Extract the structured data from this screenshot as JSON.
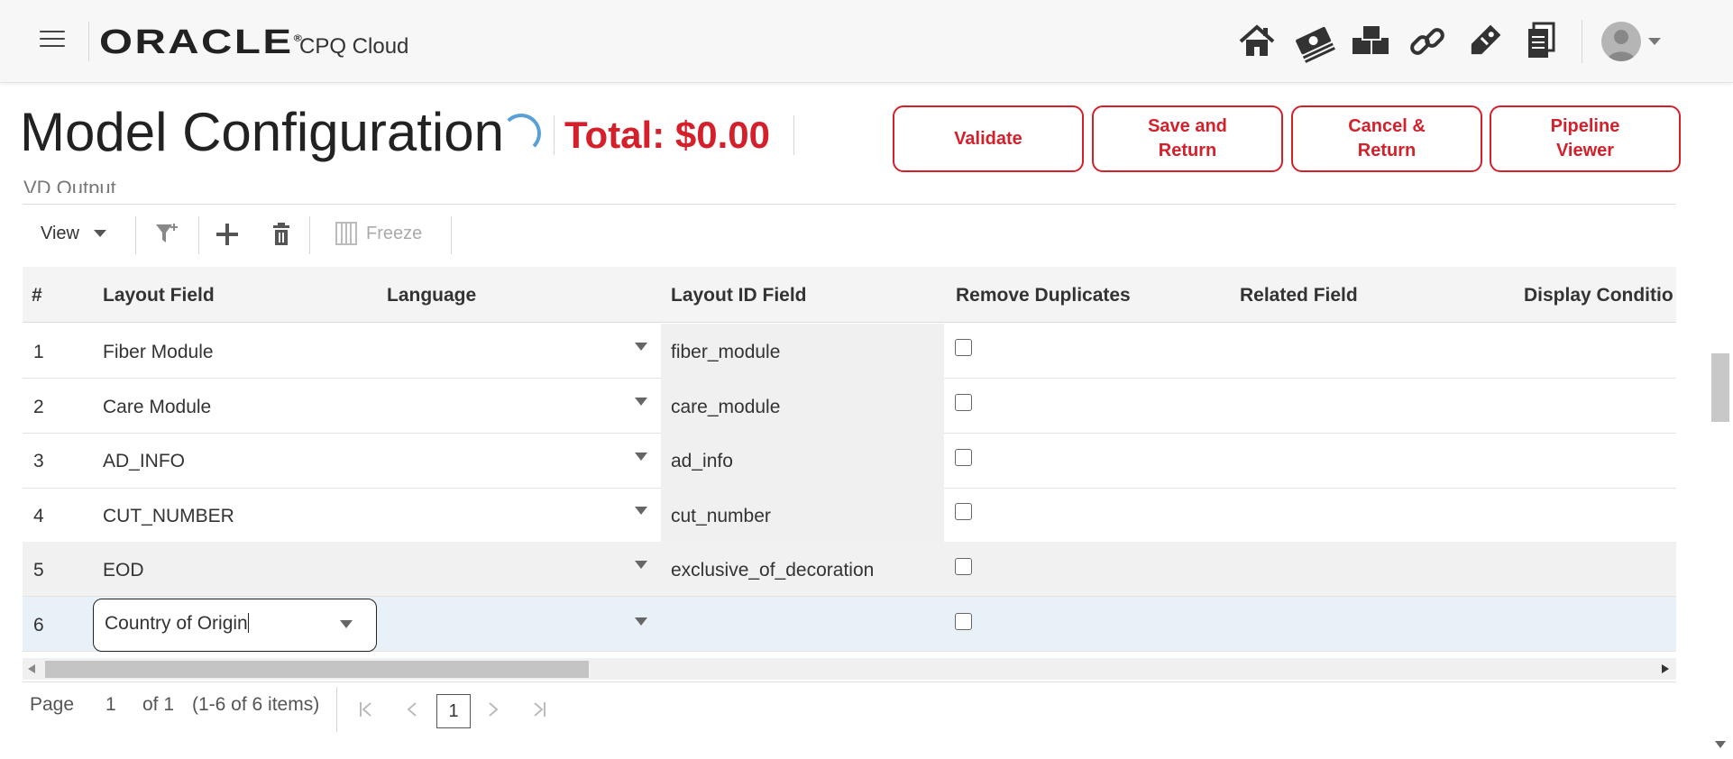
{
  "header": {
    "brand": "ORACLE",
    "brand_mark": "®",
    "product": "CPQ Cloud",
    "nav_icons": [
      "home-icon",
      "money-icon",
      "boxes-icon",
      "link-icon",
      "tag-icon",
      "documents-icon"
    ]
  },
  "page": {
    "title": "Model Configuration",
    "total": "Total: $0.00",
    "buttons": {
      "validate": "Validate",
      "save_return_1": "Save and",
      "save_return_2": "Return",
      "cancel_return_1": "Cancel &",
      "cancel_return_2": "Return",
      "pipeline_1": "Pipeline",
      "pipeline_2": "Viewer"
    }
  },
  "section": {
    "label": "VD Output"
  },
  "toolbar": {
    "view": "View",
    "freeze": "Freeze"
  },
  "table": {
    "headers": [
      "#",
      "Layout Field",
      "Language",
      "Layout ID Field",
      "Remove Duplicates",
      "Related Field",
      "Display Conditio"
    ],
    "rows": [
      {
        "num": "1",
        "layout_field": "Fiber Module",
        "language": "",
        "layout_id": "fiber_module",
        "remove_duplicates": false
      },
      {
        "num": "2",
        "layout_field": "Care Module",
        "language": "",
        "layout_id": "care_module",
        "remove_duplicates": false
      },
      {
        "num": "3",
        "layout_field": "AD_INFO",
        "language": "",
        "layout_id": "ad_info",
        "remove_duplicates": false
      },
      {
        "num": "4",
        "layout_field": "CUT_NUMBER",
        "language": "",
        "layout_id": "cut_number",
        "remove_duplicates": false
      },
      {
        "num": "5",
        "layout_field": "EOD",
        "language": "",
        "layout_id": "exclusive_of_decoration",
        "remove_duplicates": false
      },
      {
        "num": "6",
        "layout_field": "Country of Origin",
        "language": "",
        "layout_id": "",
        "remove_duplicates": false
      }
    ]
  },
  "pager": {
    "page_label": "Page",
    "page_value": "1",
    "of_label": "of 1",
    "items": "(1-6 of 6 items)",
    "current": "1"
  },
  "colors": {
    "accent": "#d4202a",
    "spinner": "#5aa0d6",
    "selected_row": "#e8f1f8"
  }
}
